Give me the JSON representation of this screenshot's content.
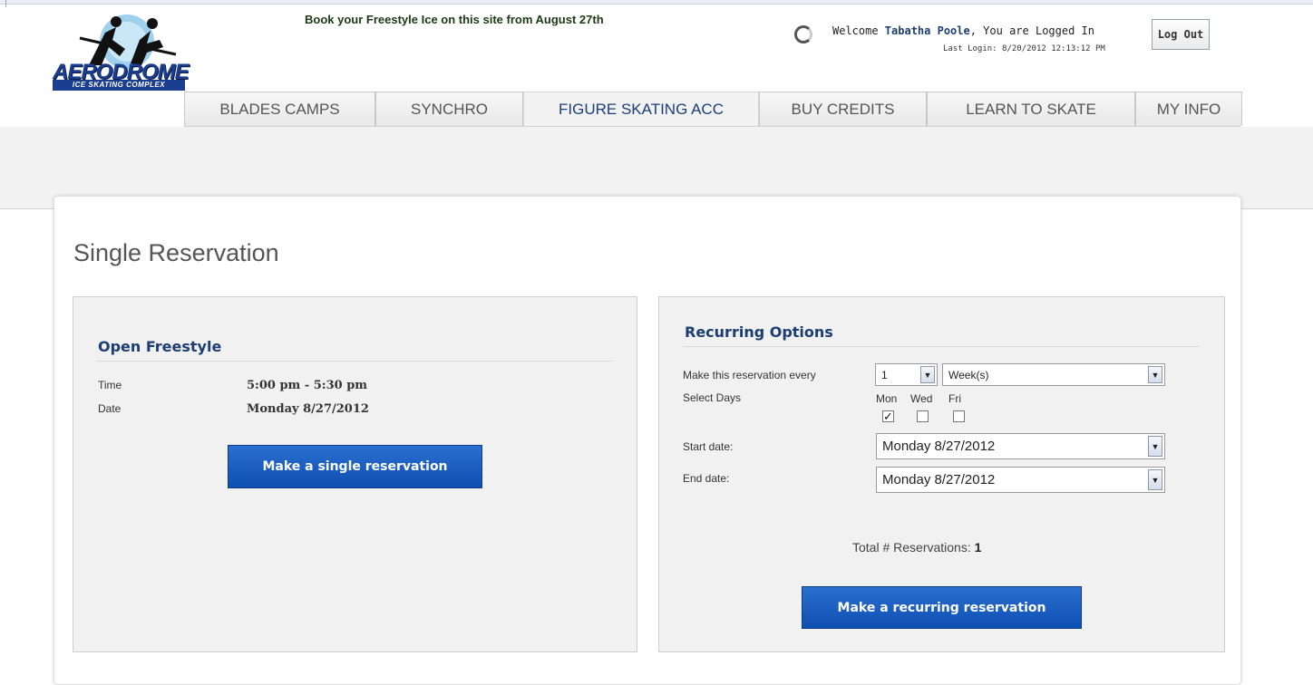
{
  "header": {
    "logo": {
      "name": "AERODROME",
      "subtitle": "ICE SKATING COMPLEX"
    },
    "announcement": "Book your Freestyle Ice on this site from August 27th",
    "welcome_prefix": "Welcome ",
    "user_name": "Tabatha Poole",
    "welcome_suffix": ", You are Logged In",
    "last_login": "Last Login: 8/20/2012 12:13:12 PM",
    "logout_label": "Log Out"
  },
  "tabs": [
    {
      "label": "BLADES CAMPS",
      "active": false
    },
    {
      "label": "SYNCHRO",
      "active": false
    },
    {
      "label": "FIGURE SKATING ACC",
      "active": true
    },
    {
      "label": "BUY CREDITS",
      "active": false
    },
    {
      "label": "LEARN TO SKATE",
      "active": false
    },
    {
      "label": "MY INFO",
      "active": false
    }
  ],
  "page_title": "Single Reservation",
  "single": {
    "heading": "Open Freestyle",
    "time_label": "Time",
    "time_value": "5:00 pm - 5:30 pm",
    "date_label": "Date",
    "date_value": "Monday 8/27/2012",
    "button_label": "Make a single reservation"
  },
  "recurring": {
    "heading": "Recurring Options",
    "every_label": "Make this reservation every",
    "every_count": "1",
    "every_unit": "Week(s)",
    "select_days_label": "Select Days",
    "days": [
      {
        "label": "Mon",
        "checked": true
      },
      {
        "label": "Wed",
        "checked": false
      },
      {
        "label": "Fri",
        "checked": false
      }
    ],
    "start_label": "Start date:",
    "start_value": "Monday 8/27/2012",
    "end_label": "End date:",
    "end_value": "Monday 8/27/2012",
    "total_label": "Total # Reservations: ",
    "total_value": "1",
    "button_label": "Make a recurring reservation"
  },
  "colors": {
    "accent_blue": "#1c3e72",
    "button_blue": "#0e4fb2",
    "panel_grey": "#f1f1f1"
  },
  "icons": [
    "loading-spinner-icon",
    "chevron-down-icon",
    "checkbox"
  ]
}
